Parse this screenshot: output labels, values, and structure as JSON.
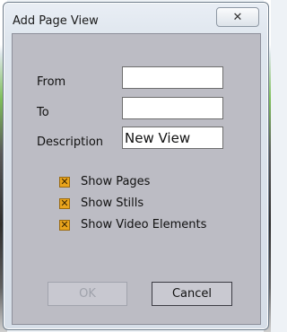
{
  "window": {
    "title": "Add Page View",
    "close_icon": "close-icon",
    "close_glyph": "✕"
  },
  "form": {
    "from_label": "From",
    "from_value": "",
    "to_label": "To",
    "to_value": "",
    "description_label": "Description",
    "description_value": "New View"
  },
  "options": {
    "show_pages": {
      "label": "Show Pages",
      "checked": true
    },
    "show_stills": {
      "label": "Show Stills",
      "checked": true
    },
    "show_video": {
      "label": "Show Video Elements",
      "checked": true
    },
    "check_glyph": "✕"
  },
  "buttons": {
    "ok_label": "OK",
    "ok_enabled": false,
    "cancel_label": "Cancel"
  },
  "colors": {
    "checkbox": "#e9a41c",
    "client_bg": "#bcbcc4"
  }
}
